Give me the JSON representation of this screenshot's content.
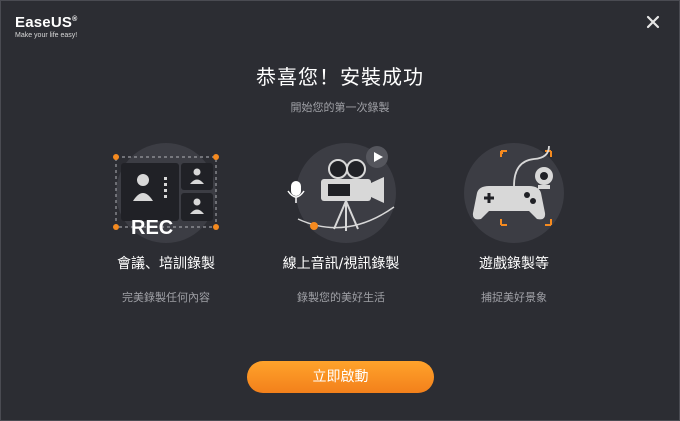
{
  "brand": {
    "name": "EaseUS",
    "reg": "®",
    "tagline": "Make your life easy!"
  },
  "header": {
    "title": "恭喜您！安裝成功",
    "subtitle": "開始您的第一次錄製"
  },
  "features": [
    {
      "name": "會議、培訓錄製",
      "desc": "完美錄製任何內容",
      "badge": "REC",
      "icon": "meeting-recording-icon"
    },
    {
      "name": "線上音訊/視訊錄製",
      "desc": "錄製您的美好生活",
      "icon": "video-camera-icon"
    },
    {
      "name": "遊戲錄製等",
      "desc": "捕捉美好景象",
      "icon": "gamepad-icon"
    }
  ],
  "actions": {
    "start_label": "立即啟動",
    "close_icon": "close-icon"
  },
  "colors": {
    "background": "#2c2d33",
    "accent": "#f58a1f",
    "circle": "#3c3d44"
  }
}
